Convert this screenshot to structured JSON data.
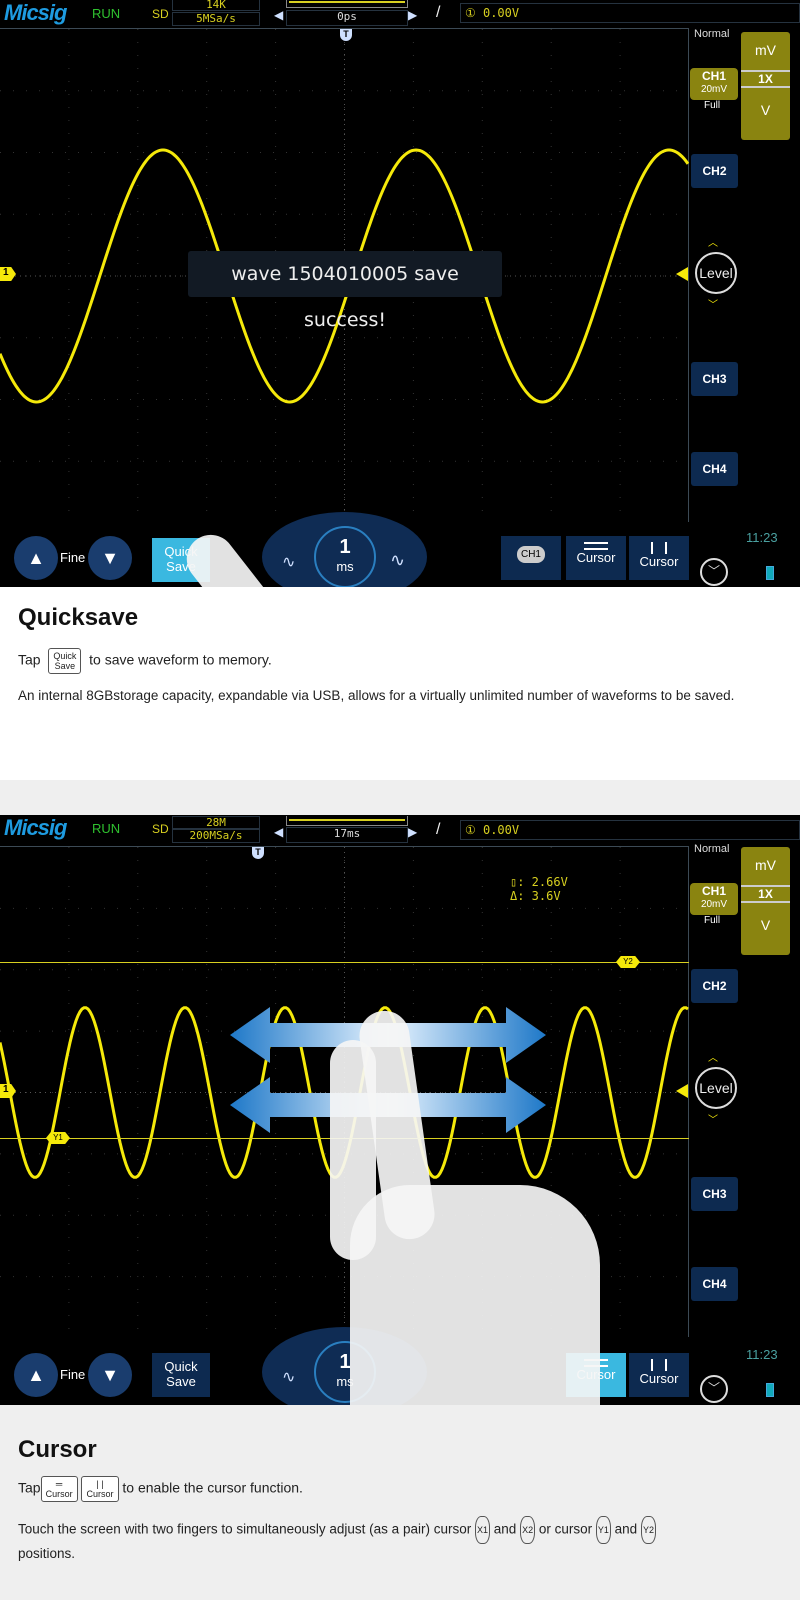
{
  "colors": {
    "trace": "#f5e90a",
    "accent": "#1e9be0",
    "panel": "#8a8410",
    "button": "#0d2a50"
  },
  "screen1": {
    "brand": "Micsig",
    "status": "RUN",
    "mode": "SD",
    "memory": "14K",
    "sample_rate": "5MSa/s",
    "time_offset": "0ps",
    "trigger": "① 0.00V",
    "trigger_mode": "Normal",
    "unit_top": "mV",
    "probe": "1X",
    "unit_bottom": "V",
    "ch1_label": "CH1",
    "ch1_scale": "20mV",
    "bandwidth": "Full",
    "ch2": "CH2",
    "ch3": "CH3",
    "ch4": "CH4",
    "level": "Level",
    "trigger_marker": "T",
    "ch1_marker": "1",
    "toast": "wave 1504010005 save success!",
    "fine": "Fine",
    "quick_save": "Quick Save",
    "timebase_value": "1",
    "timebase_unit": "ms",
    "ch1_menu": "CH1",
    "cursor_h": "Cursor",
    "cursor_v": "Cursor",
    "time": "11:23"
  },
  "section1": {
    "title": "Quicksave",
    "tap": "Tap",
    "key_label_1": "Quick",
    "key_label_2": "Save",
    "tap_rest": "to save waveform to memory.",
    "body": "An internal 8GBstorage capacity, expandable via USB, allows for a virtually unlimited number of waveforms to be saved."
  },
  "screen2": {
    "brand": "Micsig",
    "status": "RUN",
    "mode": "SD",
    "memory": "28M",
    "sample_rate": "200MSa/s",
    "time_offset": "17ms",
    "trigger": "① 0.00V",
    "trigger_mode": "Normal",
    "unit_top": "mV",
    "probe": "1X",
    "unit_bottom": "V",
    "ch1_label": "CH1",
    "ch1_scale": "20mV",
    "bandwidth": "Full",
    "ch2": "CH2",
    "ch3": "CH3",
    "ch4": "CH4",
    "level": "Level",
    "trigger_marker": "T",
    "ch1_marker": "1",
    "cursor_y1": "Y1",
    "cursor_y2": "Y2",
    "readout_1": "▯:  2.66V",
    "readout_2": "Δ:  3.6V",
    "fine": "Fine",
    "quick_save_1": "Quick",
    "quick_save_2": "Save",
    "timebase_value": "1",
    "timebase_unit": "ms",
    "cursor_h": "Cursor",
    "cursor_v": "Cursor",
    "time": "11:23"
  },
  "section2": {
    "title": "Cursor",
    "tap": "Tap",
    "key": "Cursor",
    "tap_rest": "to enable the cursor function.",
    "body_1": "Touch the screen with two fingers to simultaneously adjust (as a pair) cursor",
    "x1": "X1",
    "and1": "and",
    "x2": "X2",
    "or": "or cursor",
    "y1": "Y1",
    "and2": "and",
    "y2": "Y2",
    "body_2": "positions."
  }
}
